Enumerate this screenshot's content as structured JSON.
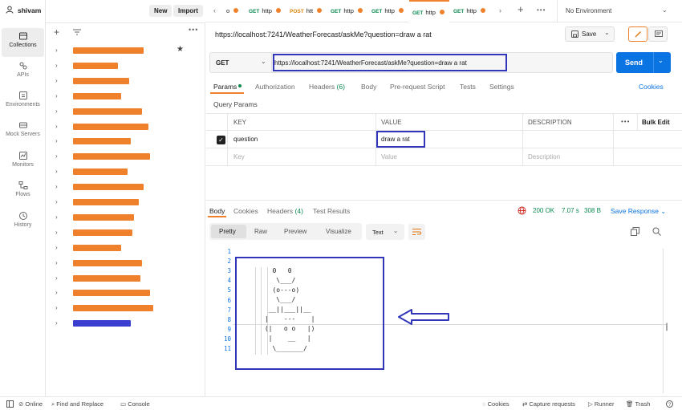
{
  "workspace": {
    "name": "shivam",
    "new_label": "New",
    "import_label": "Import"
  },
  "rail": [
    {
      "label": "Collections",
      "icon": "collections-icon"
    },
    {
      "label": "APIs",
      "icon": "apis-icon"
    },
    {
      "label": "Environments",
      "icon": "environments-icon"
    },
    {
      "label": "Mock Servers",
      "icon": "mock-servers-icon"
    },
    {
      "label": "Monitors",
      "icon": "monitors-icon"
    },
    {
      "label": "Flows",
      "icon": "flows-icon"
    },
    {
      "label": "History",
      "icon": "history-icon"
    }
  ],
  "tabs": [
    {
      "method": "GET",
      "name": "http"
    },
    {
      "method": "POST",
      "name": "htt"
    },
    {
      "method": "GET",
      "name": "http"
    },
    {
      "method": "GET",
      "name": "http"
    },
    {
      "method": "GET",
      "name": "http"
    },
    {
      "method": "GET",
      "name": "http"
    }
  ],
  "environment": "No Environment",
  "request": {
    "title": "https://localhost:7241/WeatherForecast/askMe?question=draw a rat",
    "method": "GET",
    "url": "https://localhost:7241/WeatherForecast/askMe?question=draw a rat",
    "save_label": "Save",
    "send_label": "Send"
  },
  "request_tabs": {
    "params": "Params",
    "authorization": "Authorization",
    "headers": "Headers",
    "headers_count": "(6)",
    "body": "Body",
    "pre_request": "Pre-request Script",
    "tests": "Tests",
    "settings": "Settings",
    "cookies": "Cookies"
  },
  "query_params": {
    "title": "Query Params",
    "headers": {
      "key": "KEY",
      "value": "VALUE",
      "description": "DESCRIPTION",
      "bulk_edit": "Bulk Edit"
    },
    "row": {
      "key": "question",
      "value": "draw a rat"
    },
    "placeholder": {
      "key": "Key",
      "value": "Value",
      "description": "Description"
    }
  },
  "response_tabs": {
    "body": "Body",
    "cookies": "Cookies",
    "headers": "Headers",
    "headers_count": "(4)",
    "test_results": "Test Results"
  },
  "response_status": {
    "code": "200 OK",
    "time": "7.07 s",
    "size": "308 B",
    "save_response": "Save Response"
  },
  "view_modes": {
    "pretty": "Pretty",
    "raw": "Raw",
    "preview": "Preview",
    "visualize": "Visualize",
    "format": "Text"
  },
  "line_numbers": [
    "1",
    "2",
    "3",
    "4",
    "5",
    "6",
    "7",
    "8",
    "9",
    "10",
    "11"
  ],
  "ascii_art": [
    "   0   0",
    "    \\___/",
    "   (o---o)",
    "    \\___/",
    "  __||___||__",
    " |    ---    |",
    " (|   o o   |)",
    "  |    __   |",
    "   \\_______/"
  ],
  "footer": {
    "online": "Online",
    "find_replace": "Find and Replace",
    "console": "Console",
    "cookies": "Cookies",
    "capture": "Capture requests",
    "runner": "Runner",
    "trash": "Trash"
  },
  "colors": {
    "accent": "#f0812c",
    "send": "#0b74e3",
    "highlight": "#3135b8",
    "get": "#0a8a50",
    "post": "#e0860e"
  }
}
